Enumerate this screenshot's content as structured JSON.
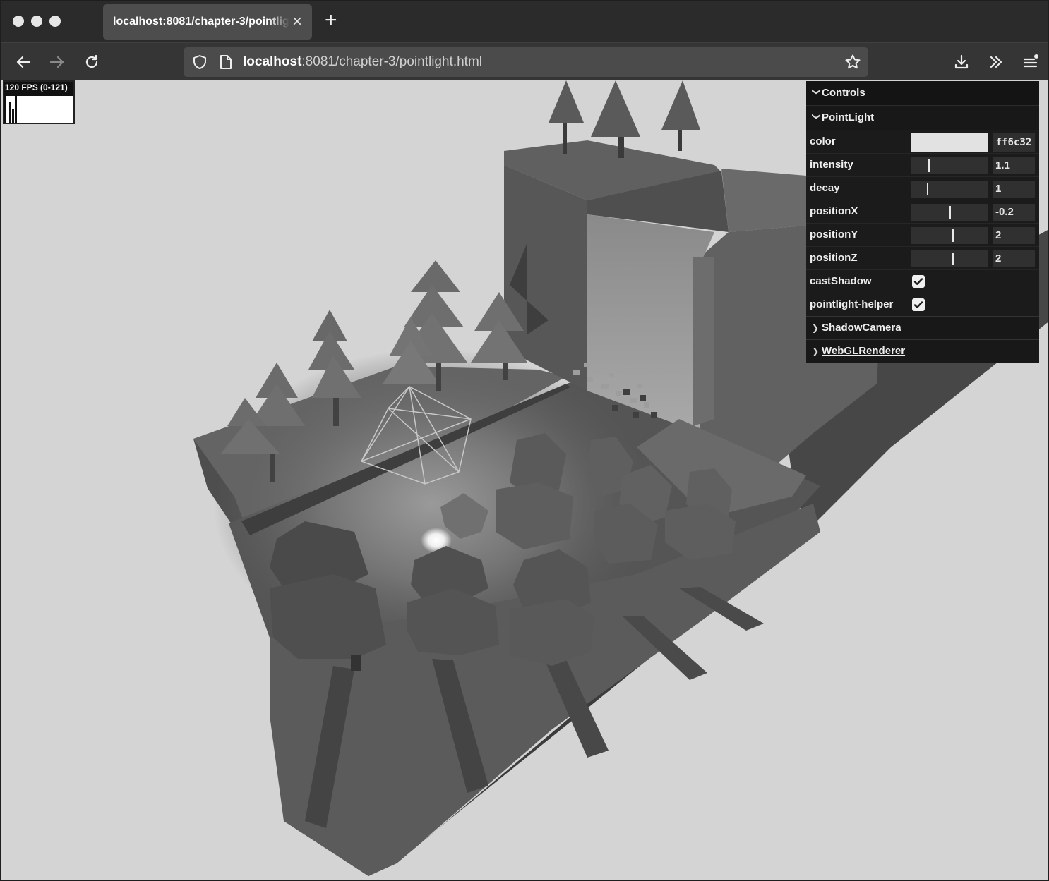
{
  "browser": {
    "tab_title": "localhost:8081/chapter-3/pointlight.html",
    "url_host": "localhost",
    "url_rest": ":8081/chapter-3/pointlight.html"
  },
  "stats": {
    "fps_label": "120 FPS (0-121)"
  },
  "gui": {
    "title": "Controls",
    "folder": "PointLight",
    "color": {
      "label": "color",
      "hex": "ff6c32"
    },
    "sliders": [
      {
        "label": "intensity",
        "value": "1.1",
        "fraction": 0.22
      },
      {
        "label": "decay",
        "value": "1",
        "fraction": 0.2
      },
      {
        "label": "positionX",
        "value": "-0.2",
        "fraction": 0.5
      },
      {
        "label": "positionY",
        "value": "2",
        "fraction": 0.54
      },
      {
        "label": "positionZ",
        "value": "2",
        "fraction": 0.54
      }
    ],
    "checkboxes": [
      {
        "label": "castShadow",
        "checked": true
      },
      {
        "label": "pointlight-helper",
        "checked": true
      }
    ],
    "subfolders": [
      {
        "label": "ShadowCamera"
      },
      {
        "label": "WebGLRenderer"
      }
    ]
  }
}
